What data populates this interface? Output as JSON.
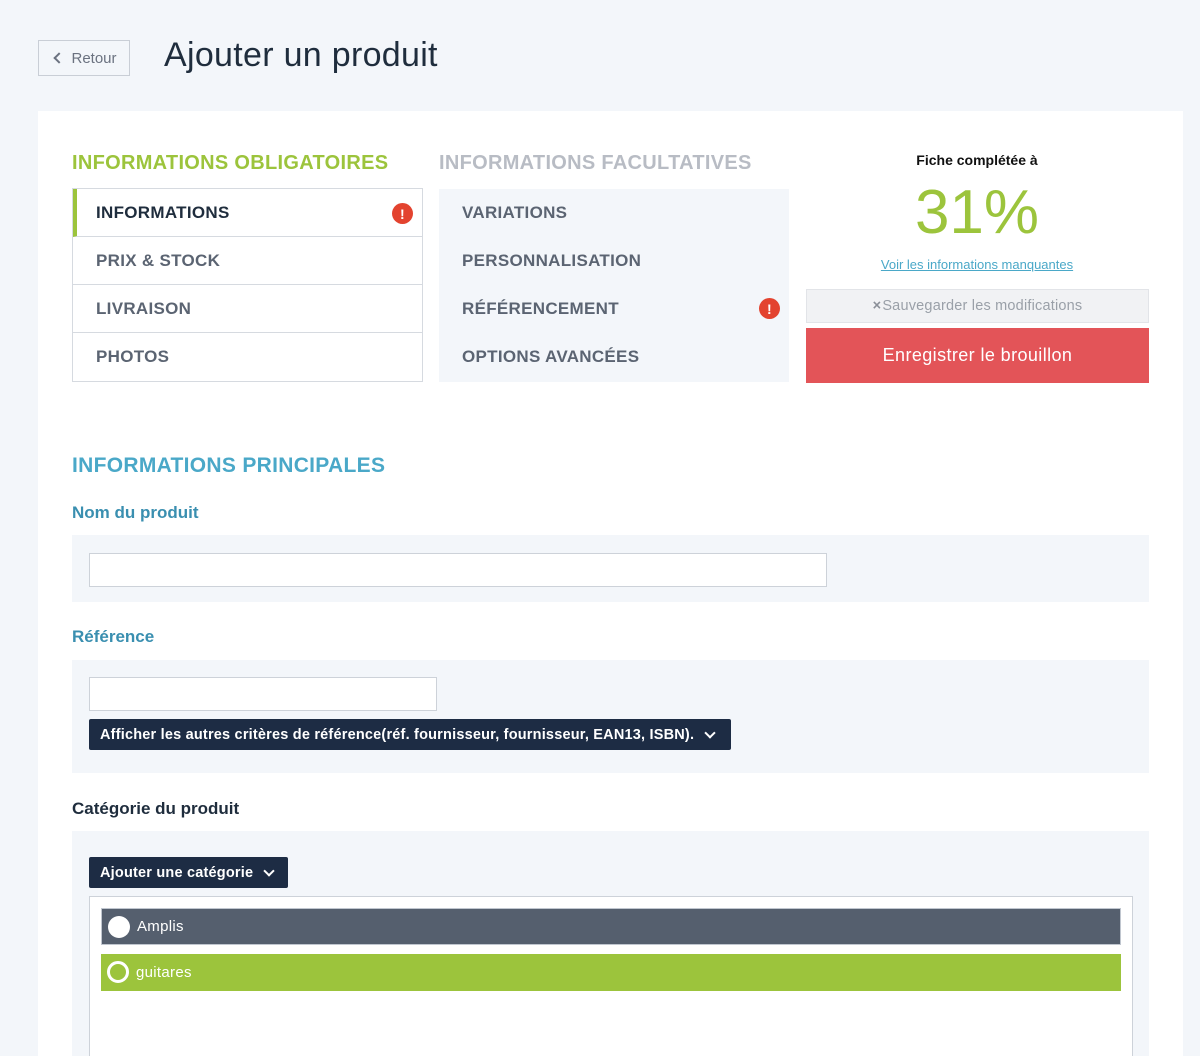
{
  "header": {
    "back_label": "Retour",
    "title": "Ajouter un produit"
  },
  "sections": {
    "required_title": "INFORMATIONS OBLIGATOIRES",
    "optional_title": "INFORMATIONS FACULTATIVES",
    "required_items": [
      {
        "label": "INFORMATIONS",
        "active": true,
        "alert": true
      },
      {
        "label": "PRIX & STOCK",
        "active": false,
        "alert": false
      },
      {
        "label": "LIVRAISON",
        "active": false,
        "alert": false
      },
      {
        "label": "PHOTOS",
        "active": false,
        "alert": false
      }
    ],
    "optional_items": [
      {
        "label": "VARIATIONS",
        "alert": false
      },
      {
        "label": "PERSONNALISATION",
        "alert": false
      },
      {
        "label": "RÉFÉRENCEMENT",
        "alert": true
      },
      {
        "label": "OPTIONS AVANCÉES",
        "alert": false
      }
    ],
    "alert_glyph": "!"
  },
  "completion": {
    "label": "Fiche complétée à",
    "percent": "31%",
    "missing_link": "Voir les informations manquantes",
    "save_icon": "×",
    "save_label": "Sauvegarder les modifications",
    "draft_label": "Enregistrer le brouillon"
  },
  "form": {
    "main_title": "INFORMATIONS PRINCIPALES",
    "name_label": "Nom du produit",
    "name_value": "",
    "reference_label": "Référence",
    "reference_value": "",
    "more_criteria_label": "Afficher les autres critères de référence(réf. fournisseur, fournisseur, EAN13, ISBN).",
    "category_label": "Catégorie du produit",
    "add_category_label": "Ajouter une catégorie",
    "categories": [
      {
        "label": "Amplis",
        "state": "gray"
      },
      {
        "label": "guitares",
        "state": "green"
      }
    ]
  },
  "colors": {
    "accent_green": "#9cc43c",
    "accent_blue": "#4aa8c8",
    "danger_red": "#e35458",
    "navy": "#1d2c44"
  }
}
